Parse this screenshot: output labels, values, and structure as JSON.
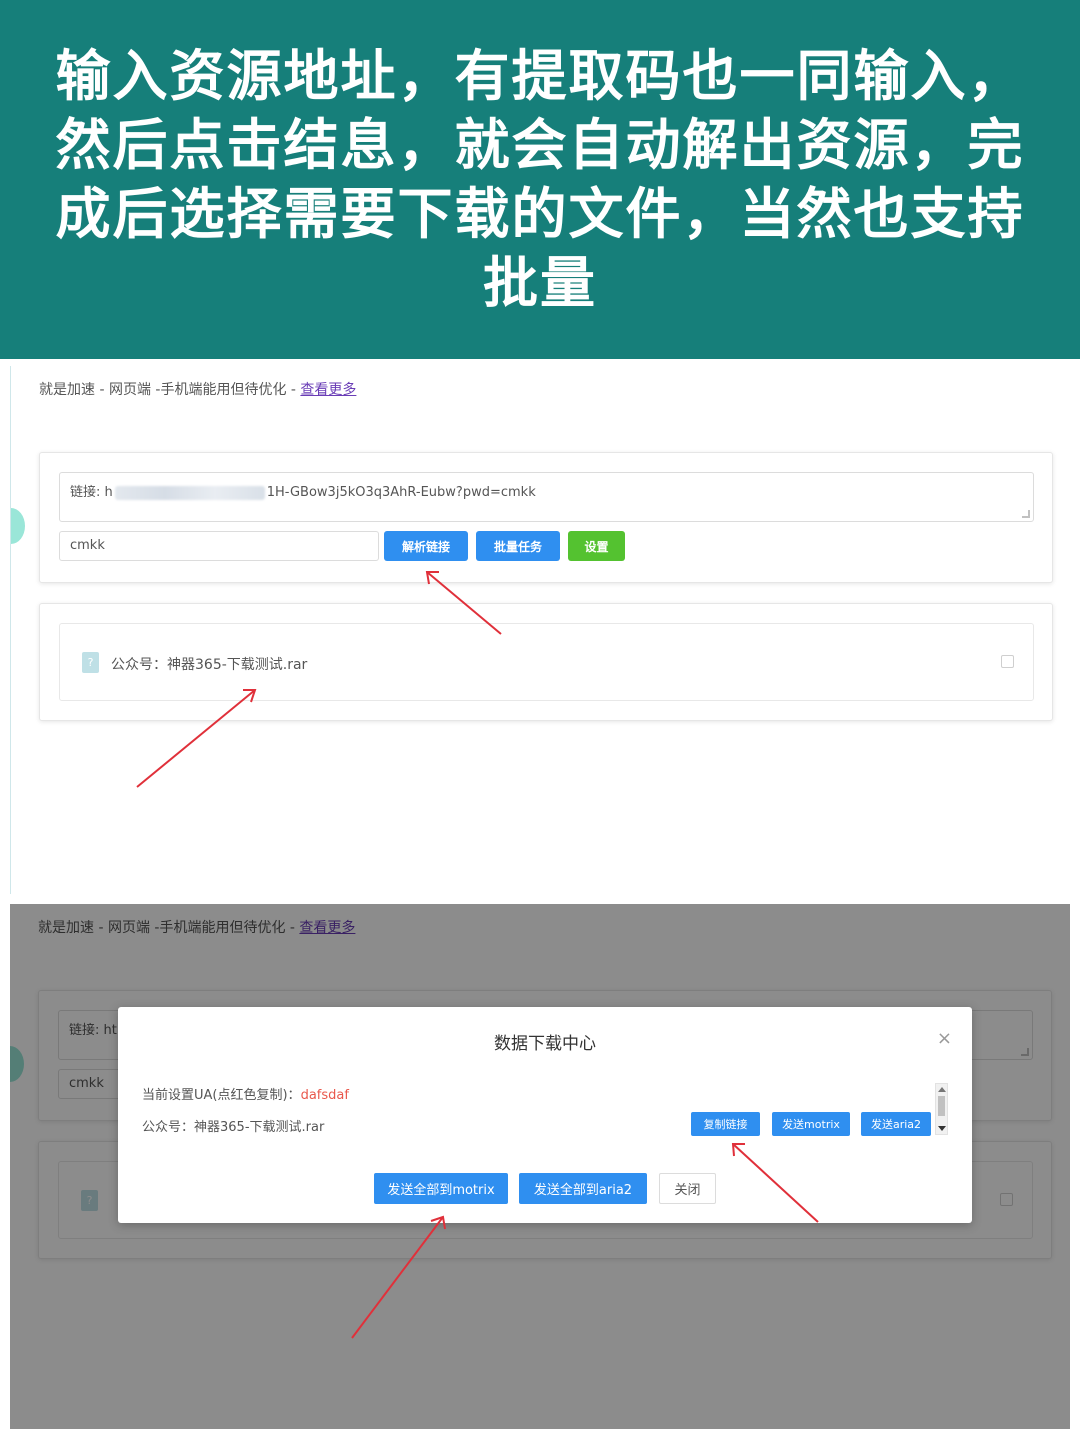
{
  "banner": {
    "lines": [
      "输入资源地址，有提取码也一同输入，",
      "然后点击结息，就会自动解出资源，完",
      "成后选择需要下载的文件，当然也支持",
      "批量"
    ]
  },
  "page": {
    "topline_text": "就是加速 - 网页端 -手机端能用但待优化 - ",
    "topline_link": "查看更多"
  },
  "form": {
    "link_label": "链接: ",
    "link_prefix_visible": "h",
    "link_suffix": "1H-GBow3j5kO3q3AhR-Eubw?pwd=cmkk",
    "link_prefix_visible_2": "ht",
    "code_value": "cmkk",
    "buttons": {
      "parse": "解析链接",
      "batch": "批量任务",
      "settings": "设置"
    },
    "colors": {
      "primary": "#2f8ff0",
      "success": "#54c230"
    }
  },
  "files": [
    {
      "name": "公众号：神器365-下载测试.rar",
      "icon": "file-icon"
    }
  ],
  "modal": {
    "title": "数据下载中心",
    "close_glyph": "×",
    "ua_label": "当前设置UA(点红色复制)：",
    "ua_value": "dafsdaf",
    "file_name": "公众号：神器365-下载测试.rar",
    "row_buttons": {
      "copy_link": "复制链接",
      "send_motrix": "发送motrix",
      "send_aria2": "发送aria2"
    },
    "footer_buttons": {
      "send_all_motrix": "发送全部到motrix",
      "send_all_aria2": "发送全部到aria2",
      "close": "关闭"
    }
  },
  "annotations": {
    "arrow_color": "#e0303a"
  }
}
